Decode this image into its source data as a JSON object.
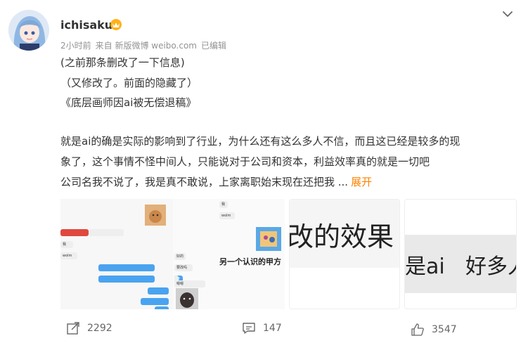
{
  "post": {
    "username": "ichisaku",
    "meta_time": "2小时前",
    "meta_source": "来自 新版微博 weibo.com",
    "meta_edited": "已编辑",
    "lines": [
      "(之前那条删改了一下信息)",
      "（又修改了。前面的隐藏了）",
      "《底层画师因ai被无偿退稿》",
      "就是ai的确是实际的影响到了行业，为什么还有这么多人不信，而且这已经是较多的现",
      "象了，这个事情不怪中间人，只能说对于公司和资本，利益效率真的就是一切吧",
      "公司名我不说了，我是真不敢说，上家离职始末现在还把我 ..."
    ],
    "expand_label": "展开"
  },
  "images": {
    "chat_caption": "另一个认识的甲方",
    "chat_small": [
      "我",
      "wolm",
      "我",
      "wolm",
      "好的",
      "要改吗",
      "好",
      "嗯嗯"
    ],
    "img2_text": "改的效果",
    "img3_text_a": "是ai",
    "img3_text_b": "好多人"
  },
  "actions": {
    "share_count": "2292",
    "comment_count": "147",
    "like_count": "3547"
  },
  "colors": {
    "expand": "#ff8200",
    "meta": "#939393",
    "chat_blue": "#4aa3f0"
  }
}
